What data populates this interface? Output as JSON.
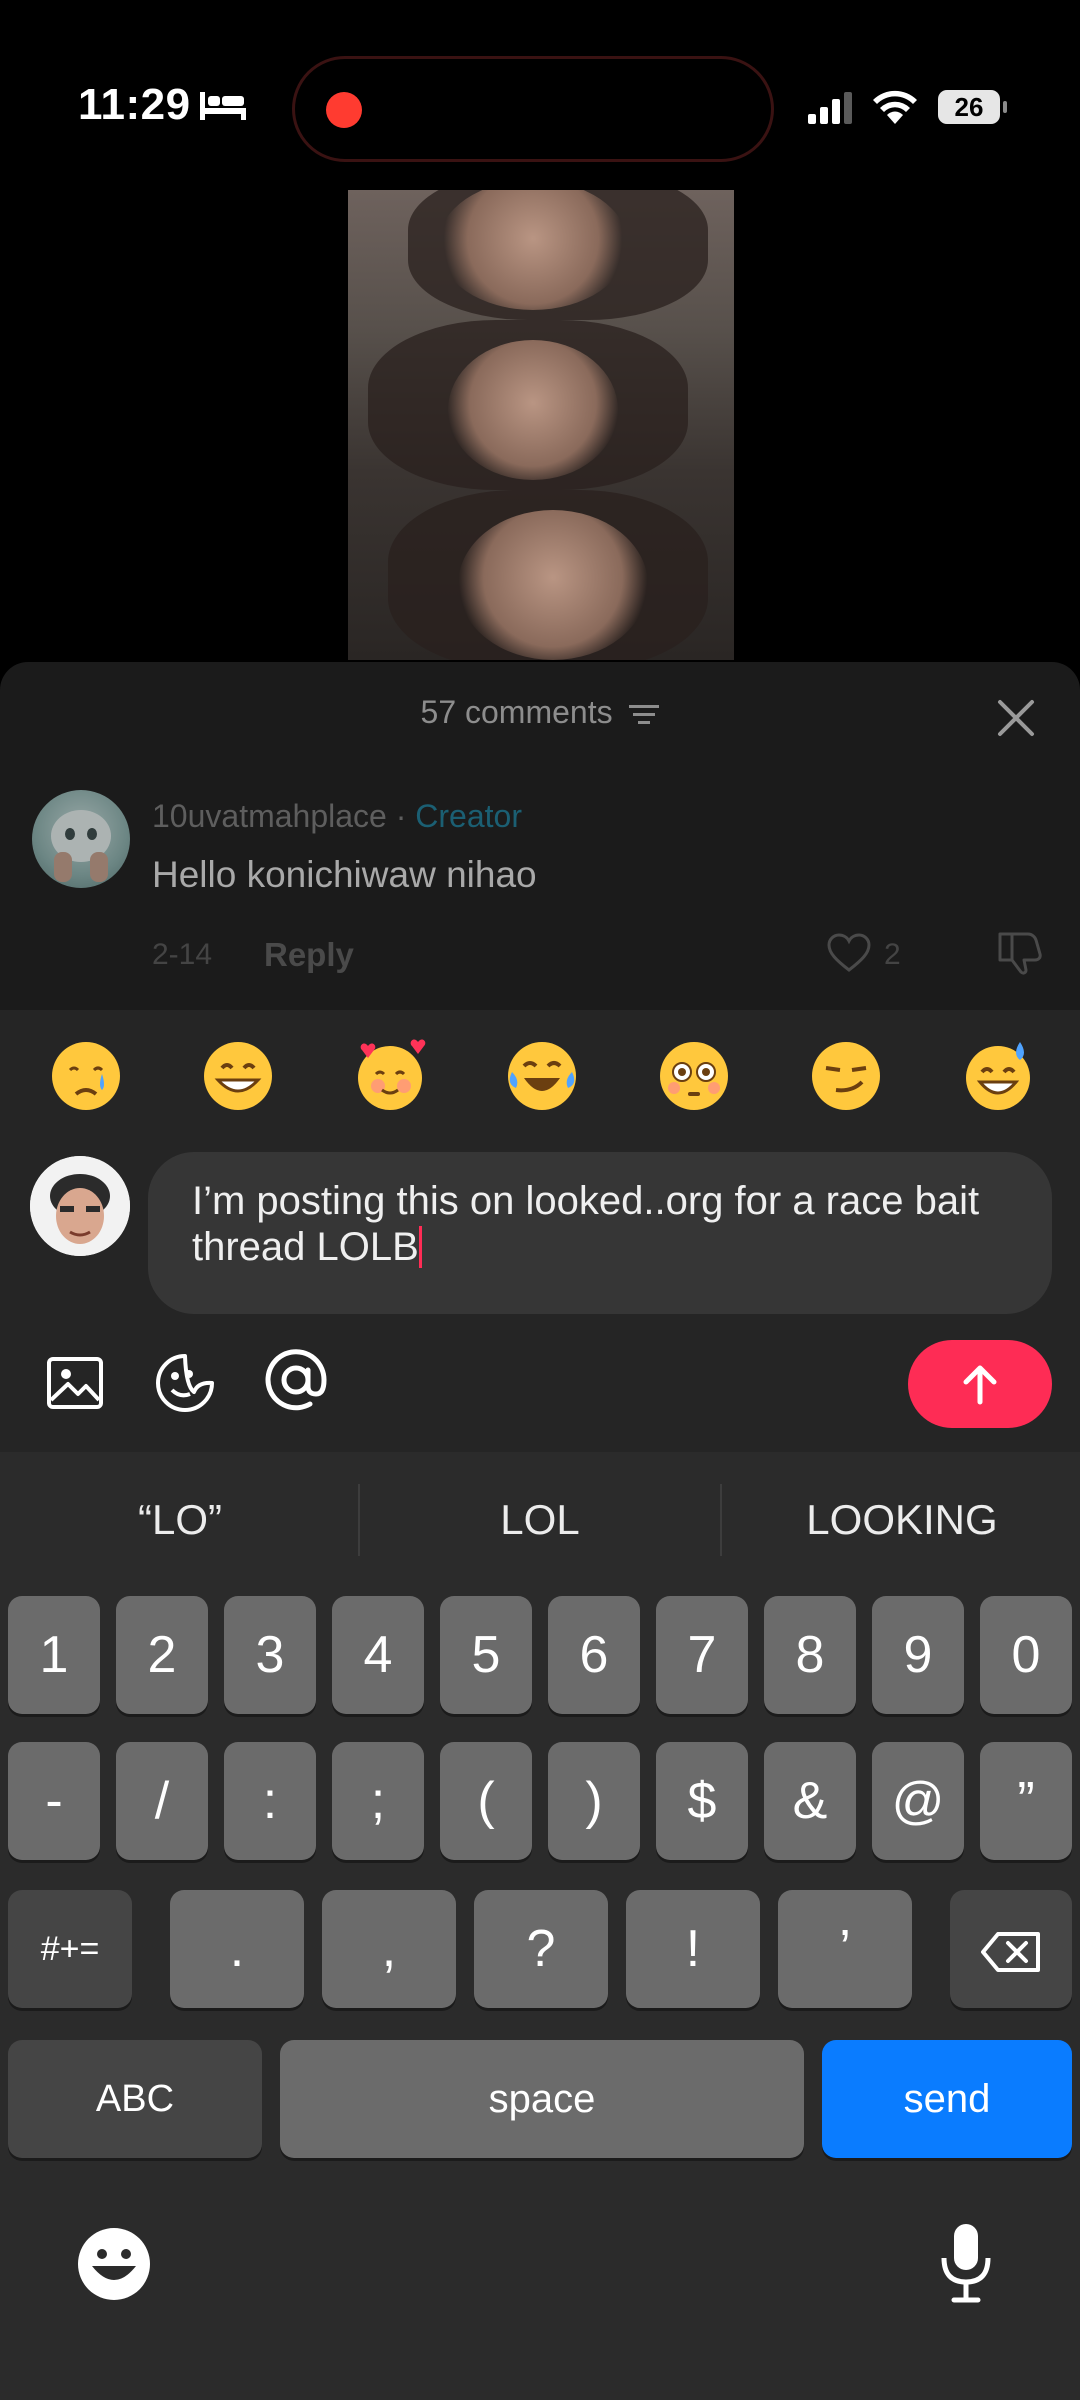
{
  "status_bar": {
    "time": "11:29",
    "battery": "26"
  },
  "comments": {
    "header": "57 comments",
    "items": [
      {
        "username": "10uvatmahplace",
        "separator": " · ",
        "badge": "Creator",
        "text": "Hello konichiwaw nihao",
        "date": "2-14",
        "reply_label": "Reply",
        "likes": "2"
      }
    ]
  },
  "quick_emojis": [
    "😢",
    "😁",
    "🥰",
    "😂",
    "😳",
    "😏",
    "😅"
  ],
  "composer": {
    "text": "I’m posting this on looked..org for a race bait thread LOLB"
  },
  "keyboard": {
    "suggestions": [
      "“LO”",
      "LOL",
      "LOOKING"
    ],
    "row1": [
      "1",
      "2",
      "3",
      "4",
      "5",
      "6",
      "7",
      "8",
      "9",
      "0"
    ],
    "row2": [
      "-",
      "/",
      ":",
      ";",
      "(",
      ")",
      "$",
      "&",
      "@",
      "”"
    ],
    "row3_left": "#+=",
    "row3": [
      ".",
      ",",
      "?",
      "!",
      "’"
    ],
    "abc": "ABC",
    "space": "space",
    "send": "send"
  },
  "colors": {
    "accent": "#fe2c55",
    "keyboard_send": "#0a7cff",
    "creator_badge": "#1b5f73"
  }
}
